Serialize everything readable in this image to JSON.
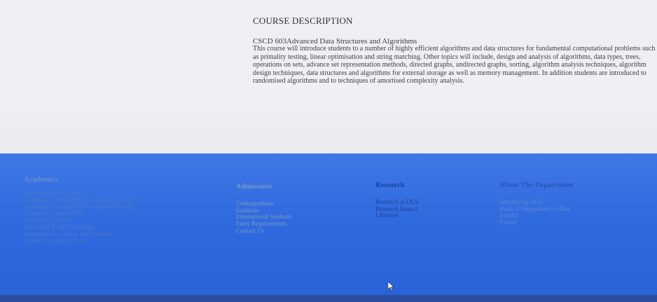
{
  "course": {
    "heading": "COURSE DESCRIPTION",
    "title": "CSCD 603Advanced Data Structures and Algorithms",
    "description": "This course will introduce students to a number of highly efficient algorithms and data structures for fundamental computational problems such as primality testing, linear optimisation and string matching. Other topics will include, design and analysis of algorithms, data types, trees, operations on sets, advance set representation methods, directed graphs, undirected graphs, sorting, algorithm analysis techniques, algorithm design techniques, data structures and algorithms for external storage as well as memory management. In addition students are introduced to randomised algorithms and to techniques of amortised complexity analysis."
  },
  "footer": {
    "academics": {
      "heading": "Academics",
      "items": [
        "Undergraduate Courses",
        "Graduate Courses(MPhil Computer Science)",
        "Graduate Courses(MSc Computer Science)",
        "Graduate Courses(PhD)",
        "Academic Calendar",
        "Level 100 & 200 Timetable",
        "Placement Test Level 100 Students",
        "Student Complaint Form"
      ]
    },
    "admissions": {
      "heading": "Admissions",
      "items": [
        "Undergraduate",
        "Graduate",
        "International Students",
        "Entry Requirements",
        "Contact Us"
      ]
    },
    "research": {
      "heading": "Research",
      "items": [
        "Research at DCS",
        "Research Impact",
        "Libraries"
      ]
    },
    "about": {
      "heading": "About The Department",
      "items": [
        "Introducing DCS",
        "Head of Department's office",
        "Faculty",
        "Events"
      ]
    }
  },
  "colors": {
    "footer_blue": "#2f6ade",
    "page_bg": "#eeeef3",
    "text_dark": "#2e2f3a"
  }
}
